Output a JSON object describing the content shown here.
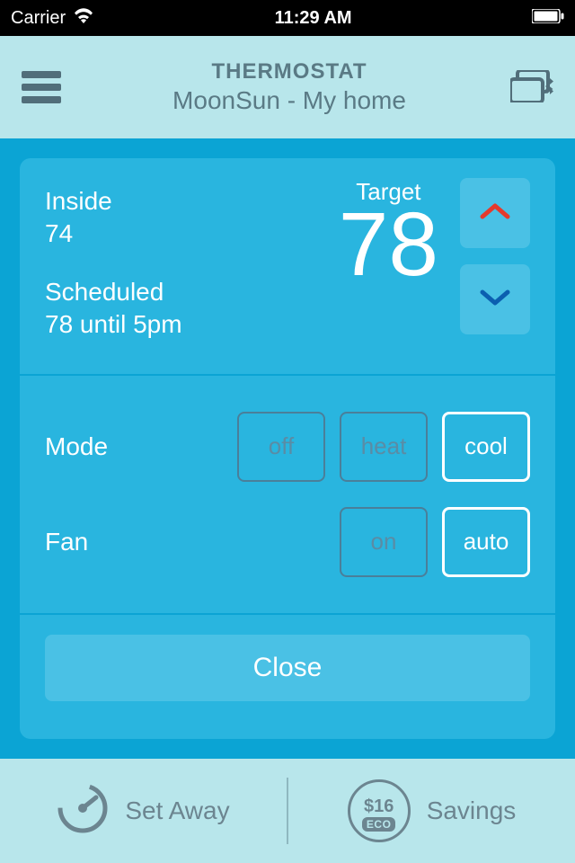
{
  "status": {
    "carrier": "Carrier",
    "time": "11:29 AM"
  },
  "header": {
    "title": "THERMOSTAT",
    "subtitle": "MoonSun - My home"
  },
  "temp": {
    "inside_label": "Inside",
    "inside_value": "74",
    "scheduled_label": "Scheduled",
    "scheduled_value": "78 until 5pm",
    "target_label": "Target",
    "target_value": "78"
  },
  "controls": {
    "mode_label": "Mode",
    "mode_options": {
      "off": "off",
      "heat": "heat",
      "cool": "cool"
    },
    "fan_label": "Fan",
    "fan_options": {
      "on": "on",
      "auto": "auto"
    }
  },
  "close_label": "Close",
  "footer": {
    "set_away": "Set Away",
    "savings": "Savings",
    "eco_amount": "$16",
    "eco_label": "ECO"
  }
}
